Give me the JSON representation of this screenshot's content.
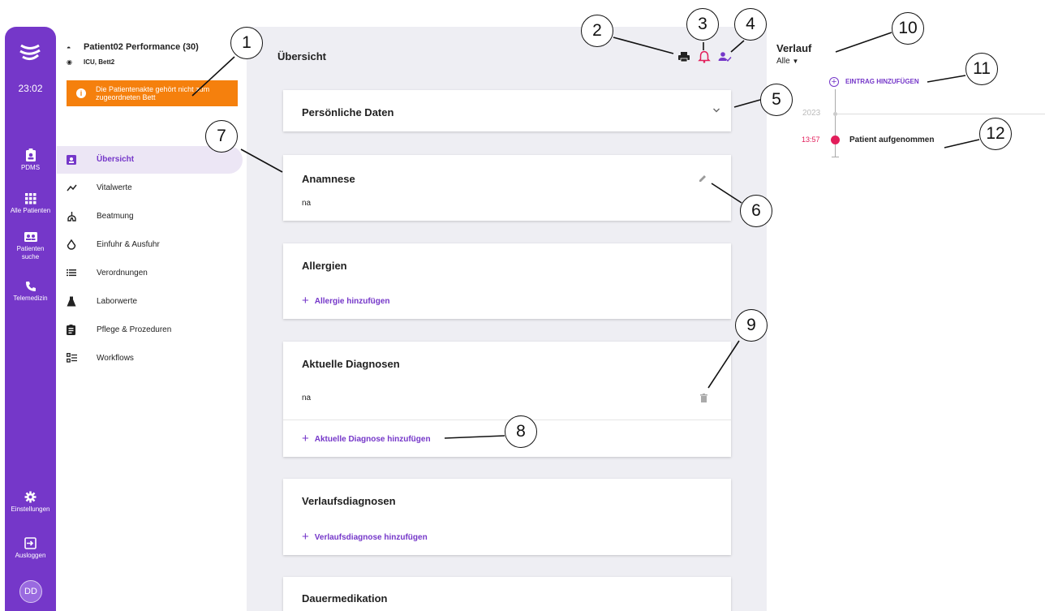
{
  "rail": {
    "time": "23:02",
    "items": [
      {
        "label": "PDMS",
        "icon": "clipboard-person-icon"
      },
      {
        "label": "Alle Patienten",
        "icon": "grid-icon"
      },
      {
        "label": "Patienten suche",
        "icon": "contact-card-icon"
      },
      {
        "label": "Telemedizin",
        "icon": "phone-icon"
      },
      {
        "label": "Einstellungen",
        "icon": "gear-icon"
      },
      {
        "label": "Ausloggen",
        "icon": "logout-icon"
      }
    ],
    "avatar": "DD",
    "accent": "#7537c9"
  },
  "patient": {
    "name": "Patient02 Performance (30)",
    "bed": "ICU, Bett2",
    "warning": "Die Patientenakte gehört nicht zum zugeordneten Bett"
  },
  "nav": [
    {
      "label": "Übersicht",
      "icon": "clipboard-person-icon",
      "active": true
    },
    {
      "label": "Vitalwerte",
      "icon": "trend-line-icon"
    },
    {
      "label": "Beatmung",
      "icon": "lungs-icon"
    },
    {
      "label": "Einfuhr & Ausfuhr",
      "icon": "drop-icon"
    },
    {
      "label": "Verordnungen",
      "icon": "list-icon"
    },
    {
      "label": "Laborwerte",
      "icon": "flask-icon"
    },
    {
      "label": "Pflege & Prozeduren",
      "icon": "clipboard-icon"
    },
    {
      "label": "Workflows",
      "icon": "checklist-icon"
    }
  ],
  "main": {
    "title": "Übersicht",
    "toolbar": {
      "print": "printer-icon",
      "alarm": "bell-icon",
      "assign": "person-check-icon"
    },
    "cards": {
      "personal": "Persönliche Daten",
      "anamnese": {
        "title": "Anamnese",
        "text": "na"
      },
      "allergies": {
        "title": "Allergien",
        "add": "Allergie hinzufügen"
      },
      "diagnoses": {
        "title": "Aktuelle Diagnosen",
        "text": "na",
        "add": "Aktuelle Diagnose hinzufügen"
      },
      "course": {
        "title": "Verlaufsdiagnosen",
        "add": "Verlaufsdiagnose hinzufügen"
      },
      "medication": {
        "title": "Dauermedikation"
      }
    }
  },
  "verlauf": {
    "title": "Verlauf",
    "filter": "Alle",
    "add": "EINTRAG HINZUFÜGEN",
    "year": "2023",
    "entry_time": "13:57",
    "entry_text": "Patient aufgenommen"
  },
  "callouts": [
    "1",
    "2",
    "3",
    "4",
    "5",
    "6",
    "7",
    "8",
    "9",
    "10",
    "11",
    "12"
  ]
}
